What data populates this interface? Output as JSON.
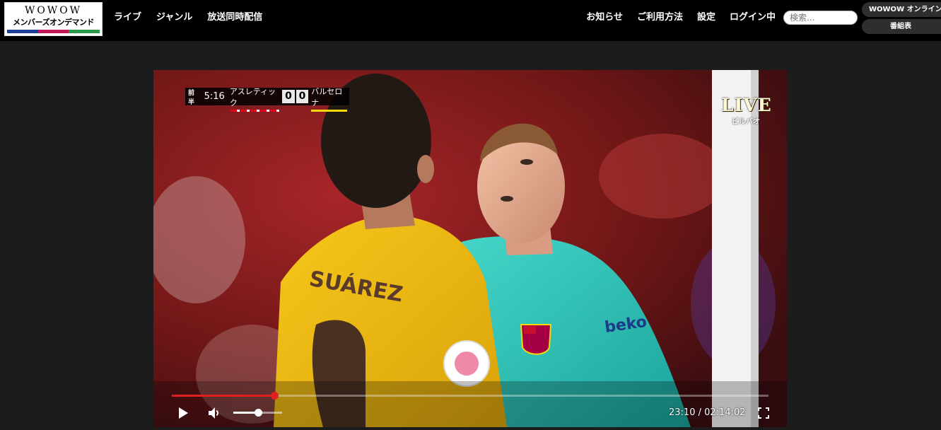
{
  "header": {
    "logo": {
      "line1": "WOWOW",
      "line2": "メンバーズオンデマンド",
      "stripe_colors": [
        "#1d3f9a",
        "#c01959",
        "#2a9a4a"
      ]
    },
    "nav_left": [
      "ライブ",
      "ジャンル",
      "放送同時配信"
    ],
    "nav_right": [
      "お知らせ",
      "ご利用方法",
      "設定",
      "ログイン中"
    ],
    "search": {
      "placeholder": "検索..."
    },
    "online_button": "WOWOW オンライン",
    "schedule_button": "番組表"
  },
  "player": {
    "scorebug": {
      "half": "前半",
      "clock": "5:16",
      "home_team": "アスレティック",
      "home_score": "0",
      "away_score": "0",
      "away_team": "バルセロナ"
    },
    "live_badge": "LIVE",
    "live_location": "ビルバオ",
    "jersey_name": "SUÁREZ",
    "sponsor": "beko",
    "progress_fraction": 0.172,
    "volume_fraction": 0.5,
    "time": {
      "current": "23:10",
      "separator": " / ",
      "duration": "02:14:02"
    },
    "colors": {
      "progress": "#e02020"
    },
    "icons": {
      "play": "play-icon",
      "volume": "volume-icon",
      "fullscreen": "fullscreen-icon"
    }
  }
}
